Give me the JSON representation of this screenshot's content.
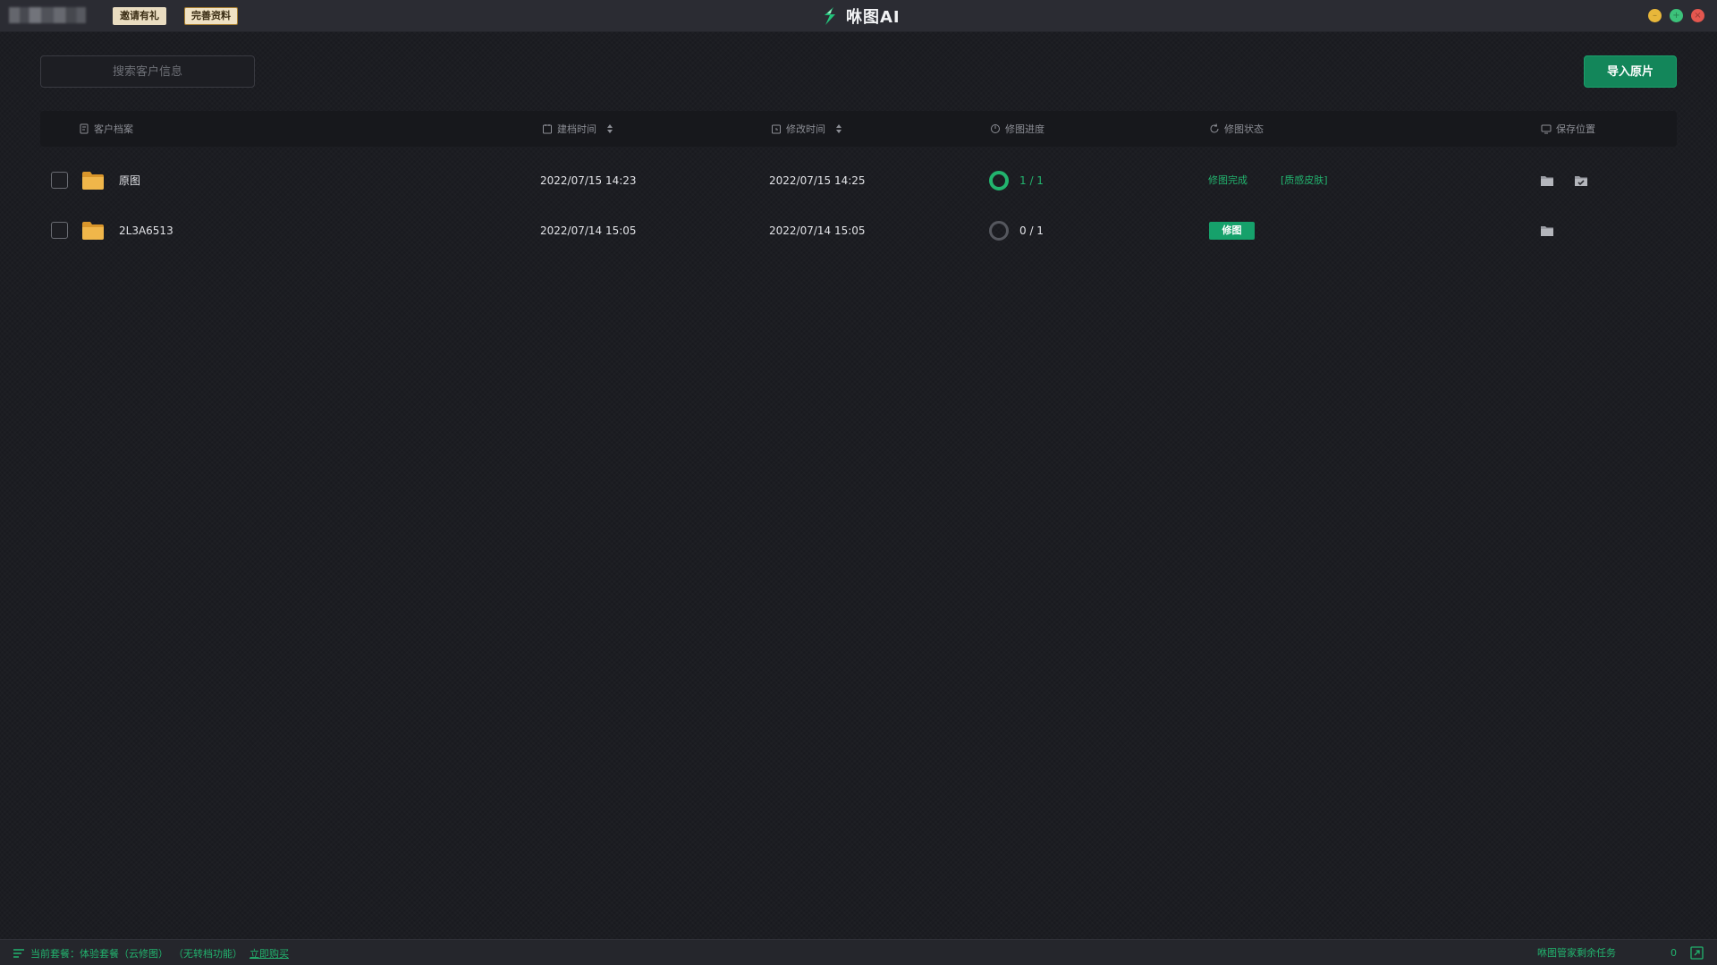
{
  "titlebar": {
    "app_name": "咻图AI",
    "invite_badge": "邀请有礼",
    "profile_badge": "完善资料",
    "logo_icon": "lightning-s-logo",
    "window_controls": [
      "minimize",
      "maximize",
      "close"
    ]
  },
  "toolbar": {
    "search_placeholder": "搜索客户信息",
    "import_label": "导入原片"
  },
  "table": {
    "headers": {
      "client": "客户档案",
      "created": "建档时间",
      "modified": "修改时间",
      "progress": "修图进度",
      "status": "修图状态",
      "save": "保存位置"
    },
    "rows": [
      {
        "name": "原图",
        "created": "2022/07/15 14:23",
        "modified": "2022/07/15 14:25",
        "progress": "1 / 1",
        "status": "修图完成",
        "tag": "[质感皮肤]"
      },
      {
        "name": "2L3A6513",
        "created": "2022/07/14 15:05",
        "modified": "2022/07/14 15:05",
        "progress": "0 / 1",
        "action": "修图"
      }
    ]
  },
  "footer": {
    "plan_label": "当前套餐：体验套餐（云修图）",
    "plan_note": "（无转档功能）",
    "buy_link": "立即购买",
    "tasks_label": "咻图管家剩余任务",
    "tasks_count": "0"
  },
  "colors": {
    "accent": "#22b36e",
    "button_green": "#13865a",
    "background": "#1c1d22",
    "titlebar": "#2b2c33",
    "folder": "#e7a93a"
  }
}
